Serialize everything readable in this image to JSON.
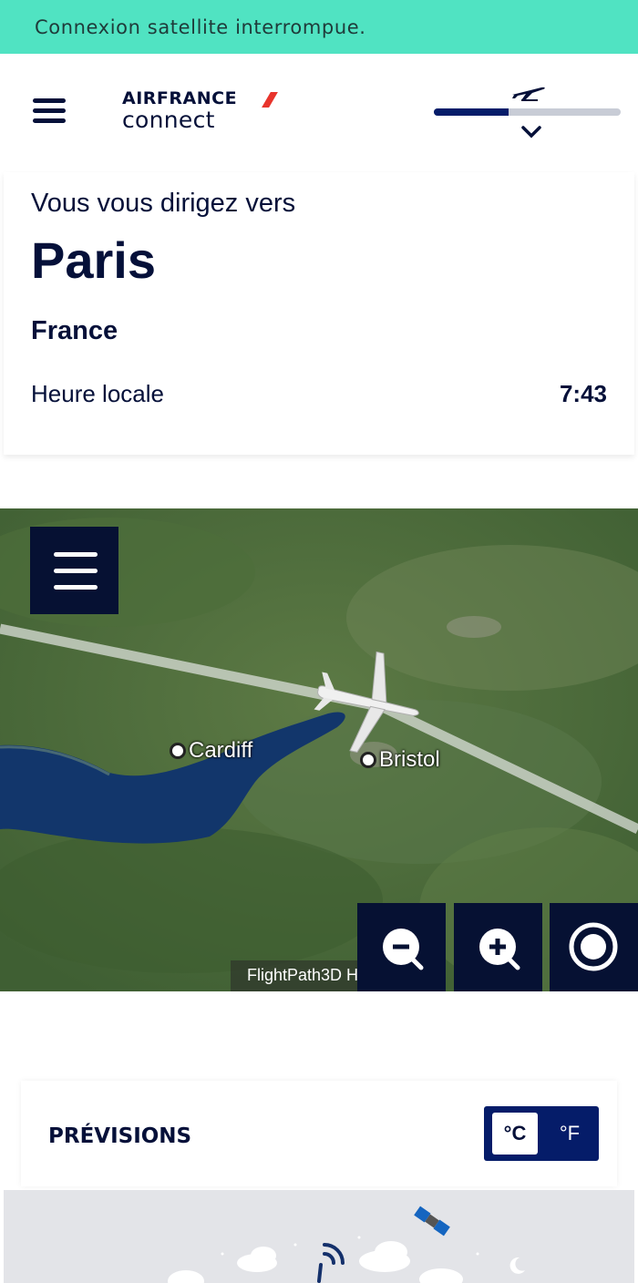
{
  "banner": {
    "text": "Connexion satellite interrompue."
  },
  "header": {
    "brand": "AIRFRANCE",
    "brand_sub": "connect",
    "flight_progress": 0.4
  },
  "destination": {
    "kicker": "Vous vous dirigez vers",
    "city": "Paris",
    "country": "France",
    "local_time_label": "Heure locale",
    "local_time": "7:43"
  },
  "map": {
    "cities": [
      {
        "name": "Cardiff"
      },
      {
        "name": "Bristol"
      }
    ],
    "credit": "FlightPath3D H",
    "controls": [
      "zoom-out",
      "zoom-in",
      "recenter"
    ]
  },
  "forecast": {
    "title": "PRÉVISIONS",
    "unit_c": "°C",
    "unit_f": "°F",
    "selected_unit": "°C"
  },
  "colors": {
    "banner": "#50e3c2",
    "navy": "#051039",
    "accent_blue": "#051c69",
    "brand_red": "#e8342c"
  }
}
